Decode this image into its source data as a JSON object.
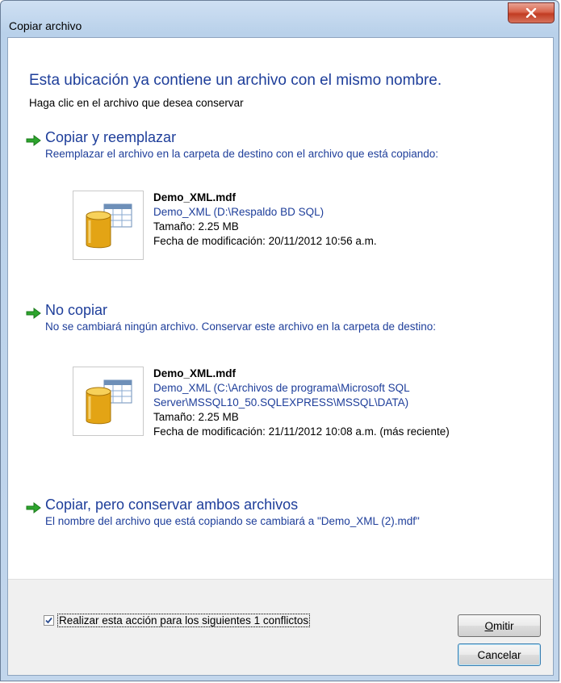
{
  "window": {
    "title": "Copiar archivo"
  },
  "header": {
    "heading": "Esta ubicación ya contiene un archivo con el mismo nombre.",
    "subheading": "Haga clic en el archivo que desea conservar"
  },
  "options": [
    {
      "title": "Copiar y reemplazar",
      "description": "Reemplazar el archivo en la carpeta de destino con el archivo que está copiando:",
      "file": {
        "name": "Demo_XML.mdf",
        "location": "Demo_XML (D:\\Respaldo BD SQL)",
        "size": "Tamaño: 2.25 MB",
        "modified": "Fecha de modificación: 20/11/2012 10:56 a.m."
      }
    },
    {
      "title": "No copiar",
      "description": "No se cambiará ningún archivo. Conservar este archivo en la carpeta de destino:",
      "file": {
        "name": "Demo_XML.mdf",
        "location": "Demo_XML (C:\\Archivos de programa\\Microsoft SQL Server\\MSSQL10_50.SQLEXPRESS\\MSSQL\\DATA)",
        "size": "Tamaño: 2.25 MB",
        "modified": "Fecha de modificación: 21/11/2012 10:08 a.m. (más reciente)"
      }
    },
    {
      "title": "Copiar, pero conservar ambos archivos",
      "description": "El nombre del archivo que está copiando se cambiará a \"Demo_XML (2).mdf\""
    }
  ],
  "footer": {
    "checkbox_label": "Realizar esta acción para los siguientes 1 conflictos",
    "checkbox_checked": true,
    "omit_label": "Omitir",
    "cancel_label": "Cancelar"
  },
  "icons": {
    "option_arrow": "green-arrow-icon",
    "file_icon": "database-file-icon",
    "close": "close-icon",
    "check": "checkmark-icon"
  },
  "colors": {
    "link_blue": "#1e3e9a",
    "arrow_green": "#2da52d",
    "close_red": "#c23b22"
  }
}
